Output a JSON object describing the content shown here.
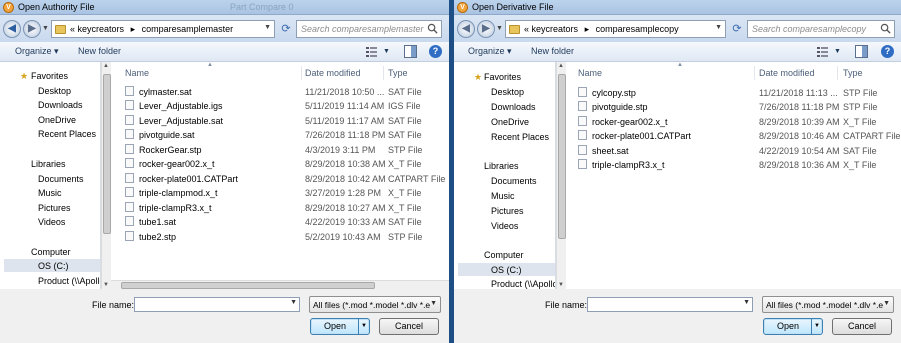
{
  "dialogs": [
    {
      "title": "Open Authority File",
      "title_ghost": "Part Compare 0",
      "breadcrumb": [
        "keycreators",
        "comparesamplemaster"
      ],
      "search_placeholder": "Search comparesamplemaster",
      "toolbar": {
        "organize": "Organize ▾",
        "new_folder": "New folder"
      },
      "nav": {
        "favorites": {
          "header": "Favorites",
          "items": [
            "Desktop",
            "Downloads",
            "OneDrive",
            "Recent Places"
          ]
        },
        "libraries": {
          "header": "Libraries",
          "items": [
            "Documents",
            "Music",
            "Pictures",
            "Videos"
          ]
        },
        "computer": {
          "header": "Computer",
          "items": [
            "OS (C:)",
            "Product (\\\\Apollo"
          ]
        }
      },
      "columns": {
        "name": "Name",
        "date": "Date modified",
        "type": "Type"
      },
      "files": [
        {
          "name": "cylmaster.sat",
          "date": "11/21/2018 10:50 ...",
          "type": "SAT File"
        },
        {
          "name": "Lever_Adjustable.igs",
          "date": "5/11/2019 11:14 AM",
          "type": "IGS File"
        },
        {
          "name": "Lever_Adjustable.sat",
          "date": "5/11/2019 11:17 AM",
          "type": "SAT File"
        },
        {
          "name": "pivotguide.sat",
          "date": "7/26/2018 11:18 PM",
          "type": "SAT File"
        },
        {
          "name": "RockerGear.stp",
          "date": "4/3/2019 3:11 PM",
          "type": "STP File"
        },
        {
          "name": "rocker-gear002.x_t",
          "date": "8/29/2018 10:38 AM",
          "type": "X_T File"
        },
        {
          "name": "rocker-plate001.CATPart",
          "date": "8/29/2018 10:42 AM",
          "type": "CATPART File"
        },
        {
          "name": "triple-clampmod.x_t",
          "date": "3/27/2019 1:28 PM",
          "type": "X_T File"
        },
        {
          "name": "triple-clampR3.x_t",
          "date": "8/29/2018 10:27 AM",
          "type": "X_T File"
        },
        {
          "name": "tube1.sat",
          "date": "4/22/2019 10:33 AM",
          "type": "SAT File"
        },
        {
          "name": "tube2.stp",
          "date": "5/2/2019 10:43 AM",
          "type": "STP File"
        }
      ],
      "file_name_label": "File name:",
      "file_name_value": "",
      "file_type": "All files (*.mod *.model *.dlv *.e",
      "open_label": "Open",
      "cancel_label": "Cancel"
    },
    {
      "title": "Open Derivative File",
      "title_ghost": "",
      "breadcrumb": [
        "keycreators",
        "comparesamplecopy"
      ],
      "search_placeholder": "Search comparesamplecopy",
      "toolbar": {
        "organize": "Organize ▾",
        "new_folder": "New folder"
      },
      "nav": {
        "favorites": {
          "header": "Favorites",
          "items": [
            "Desktop",
            "Downloads",
            "OneDrive",
            "Recent Places"
          ]
        },
        "libraries": {
          "header": "Libraries",
          "items": [
            "Documents",
            "Music",
            "Pictures",
            "Videos"
          ]
        },
        "computer": {
          "header": "Computer",
          "items": [
            "OS (C:)",
            "Product (\\\\Apollo"
          ]
        }
      },
      "columns": {
        "name": "Name",
        "date": "Date modified",
        "type": "Type"
      },
      "files": [
        {
          "name": "cylcopy.stp",
          "date": "11/21/2018 11:13 ...",
          "type": "STP File"
        },
        {
          "name": "pivotguide.stp",
          "date": "7/26/2018 11:18 PM",
          "type": "STP File"
        },
        {
          "name": "rocker-gear002.x_t",
          "date": "8/29/2018 10:39 AM",
          "type": "X_T File"
        },
        {
          "name": "rocker-plate001.CATPart",
          "date": "8/29/2018 10:46 AM",
          "type": "CATPART File"
        },
        {
          "name": "sheet.sat",
          "date": "4/22/2019 10:54 AM",
          "type": "SAT File"
        },
        {
          "name": "triple-clampR3.x_t",
          "date": "8/29/2018 10:36 AM",
          "type": "X_T File"
        }
      ],
      "file_name_label": "File name:",
      "file_name_value": "",
      "file_type": "All files (*.mod *.model *.dlv *.e",
      "open_label": "Open",
      "cancel_label": "Cancel"
    }
  ],
  "icons": [
    "app-icon",
    "back-arrow-icon",
    "forward-arrow-icon",
    "folder-icon",
    "refresh-icon",
    "search-icon",
    "view-options-icon",
    "preview-pane-icon",
    "help-icon",
    "star-icon",
    "library-icon",
    "computer-icon",
    "drive-icon",
    "file-icon"
  ],
  "colors": {
    "titlebar": "#b3cbe8",
    "selection": "#dde4ed",
    "open_button": "#bee6fd",
    "help": "#2f6cc4"
  }
}
